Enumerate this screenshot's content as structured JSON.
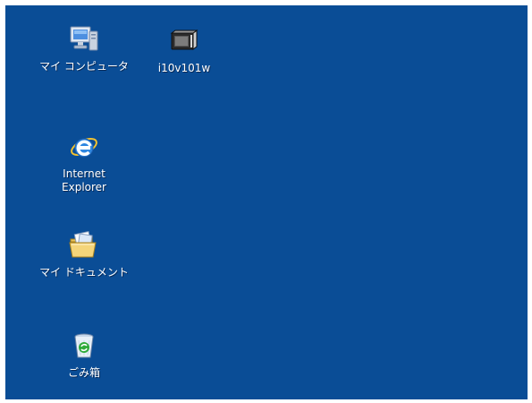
{
  "desktop": {
    "background_color": "#0a4d96",
    "icons": [
      {
        "name": "computer-icon",
        "label": "マイ コンピュータ"
      },
      {
        "name": "device-icon",
        "label": "i10v101w"
      },
      {
        "name": "internet-explorer-icon",
        "label": "Internet\nExplorer"
      },
      {
        "name": "folder-documents-icon",
        "label": "マイ ドキュメント"
      },
      {
        "name": "recycle-bin-icon",
        "label": "ごみ箱"
      }
    ]
  }
}
